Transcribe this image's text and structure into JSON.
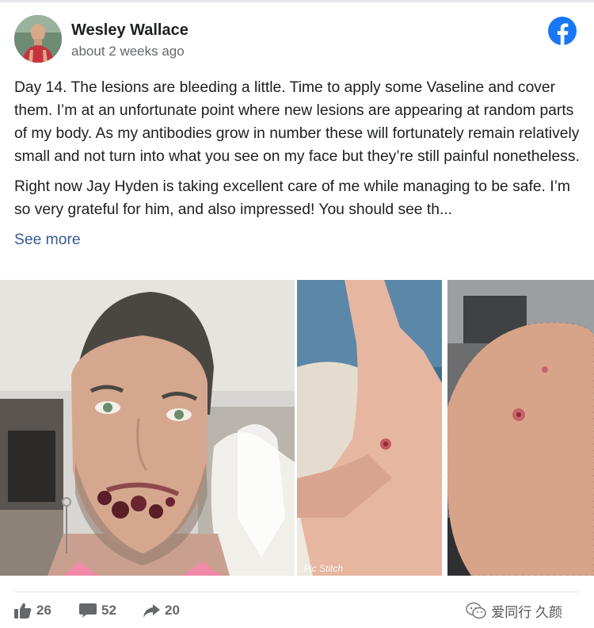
{
  "post": {
    "author": "Wesley Wallace",
    "timestamp": "about 2 weeks ago",
    "paragraphs": [
      "Day 14. The lesions are bleeding a little. Time to apply some Vaseline and cover them. I’m at an unfortunate point where new lesions are appearing at random parts of my body. As my antibodies grow in number these will fortunately remain relatively small and not turn into what you see on my face but they’re still painful nonetheless.",
      "Right now Jay Hyden is taking excellent care of me while managing to be safe. I’m so very grateful for him, and also impressed! You should see th..."
    ],
    "see_more": "See more",
    "photo_caption": "Pic Stitch"
  },
  "reactions": {
    "likes": "26",
    "comments": "52",
    "shares": "20"
  },
  "watermark": "爱同行 久颜",
  "icons": {
    "brand": "facebook-logo-icon",
    "like": "thumbs-up-icon",
    "comment": "comment-bubble-icon",
    "share": "share-arrow-icon",
    "watermark": "wechat-icon"
  },
  "colors": {
    "facebook_blue": "#1877f2",
    "link": "#385898",
    "secondary_text": "#65676b"
  }
}
